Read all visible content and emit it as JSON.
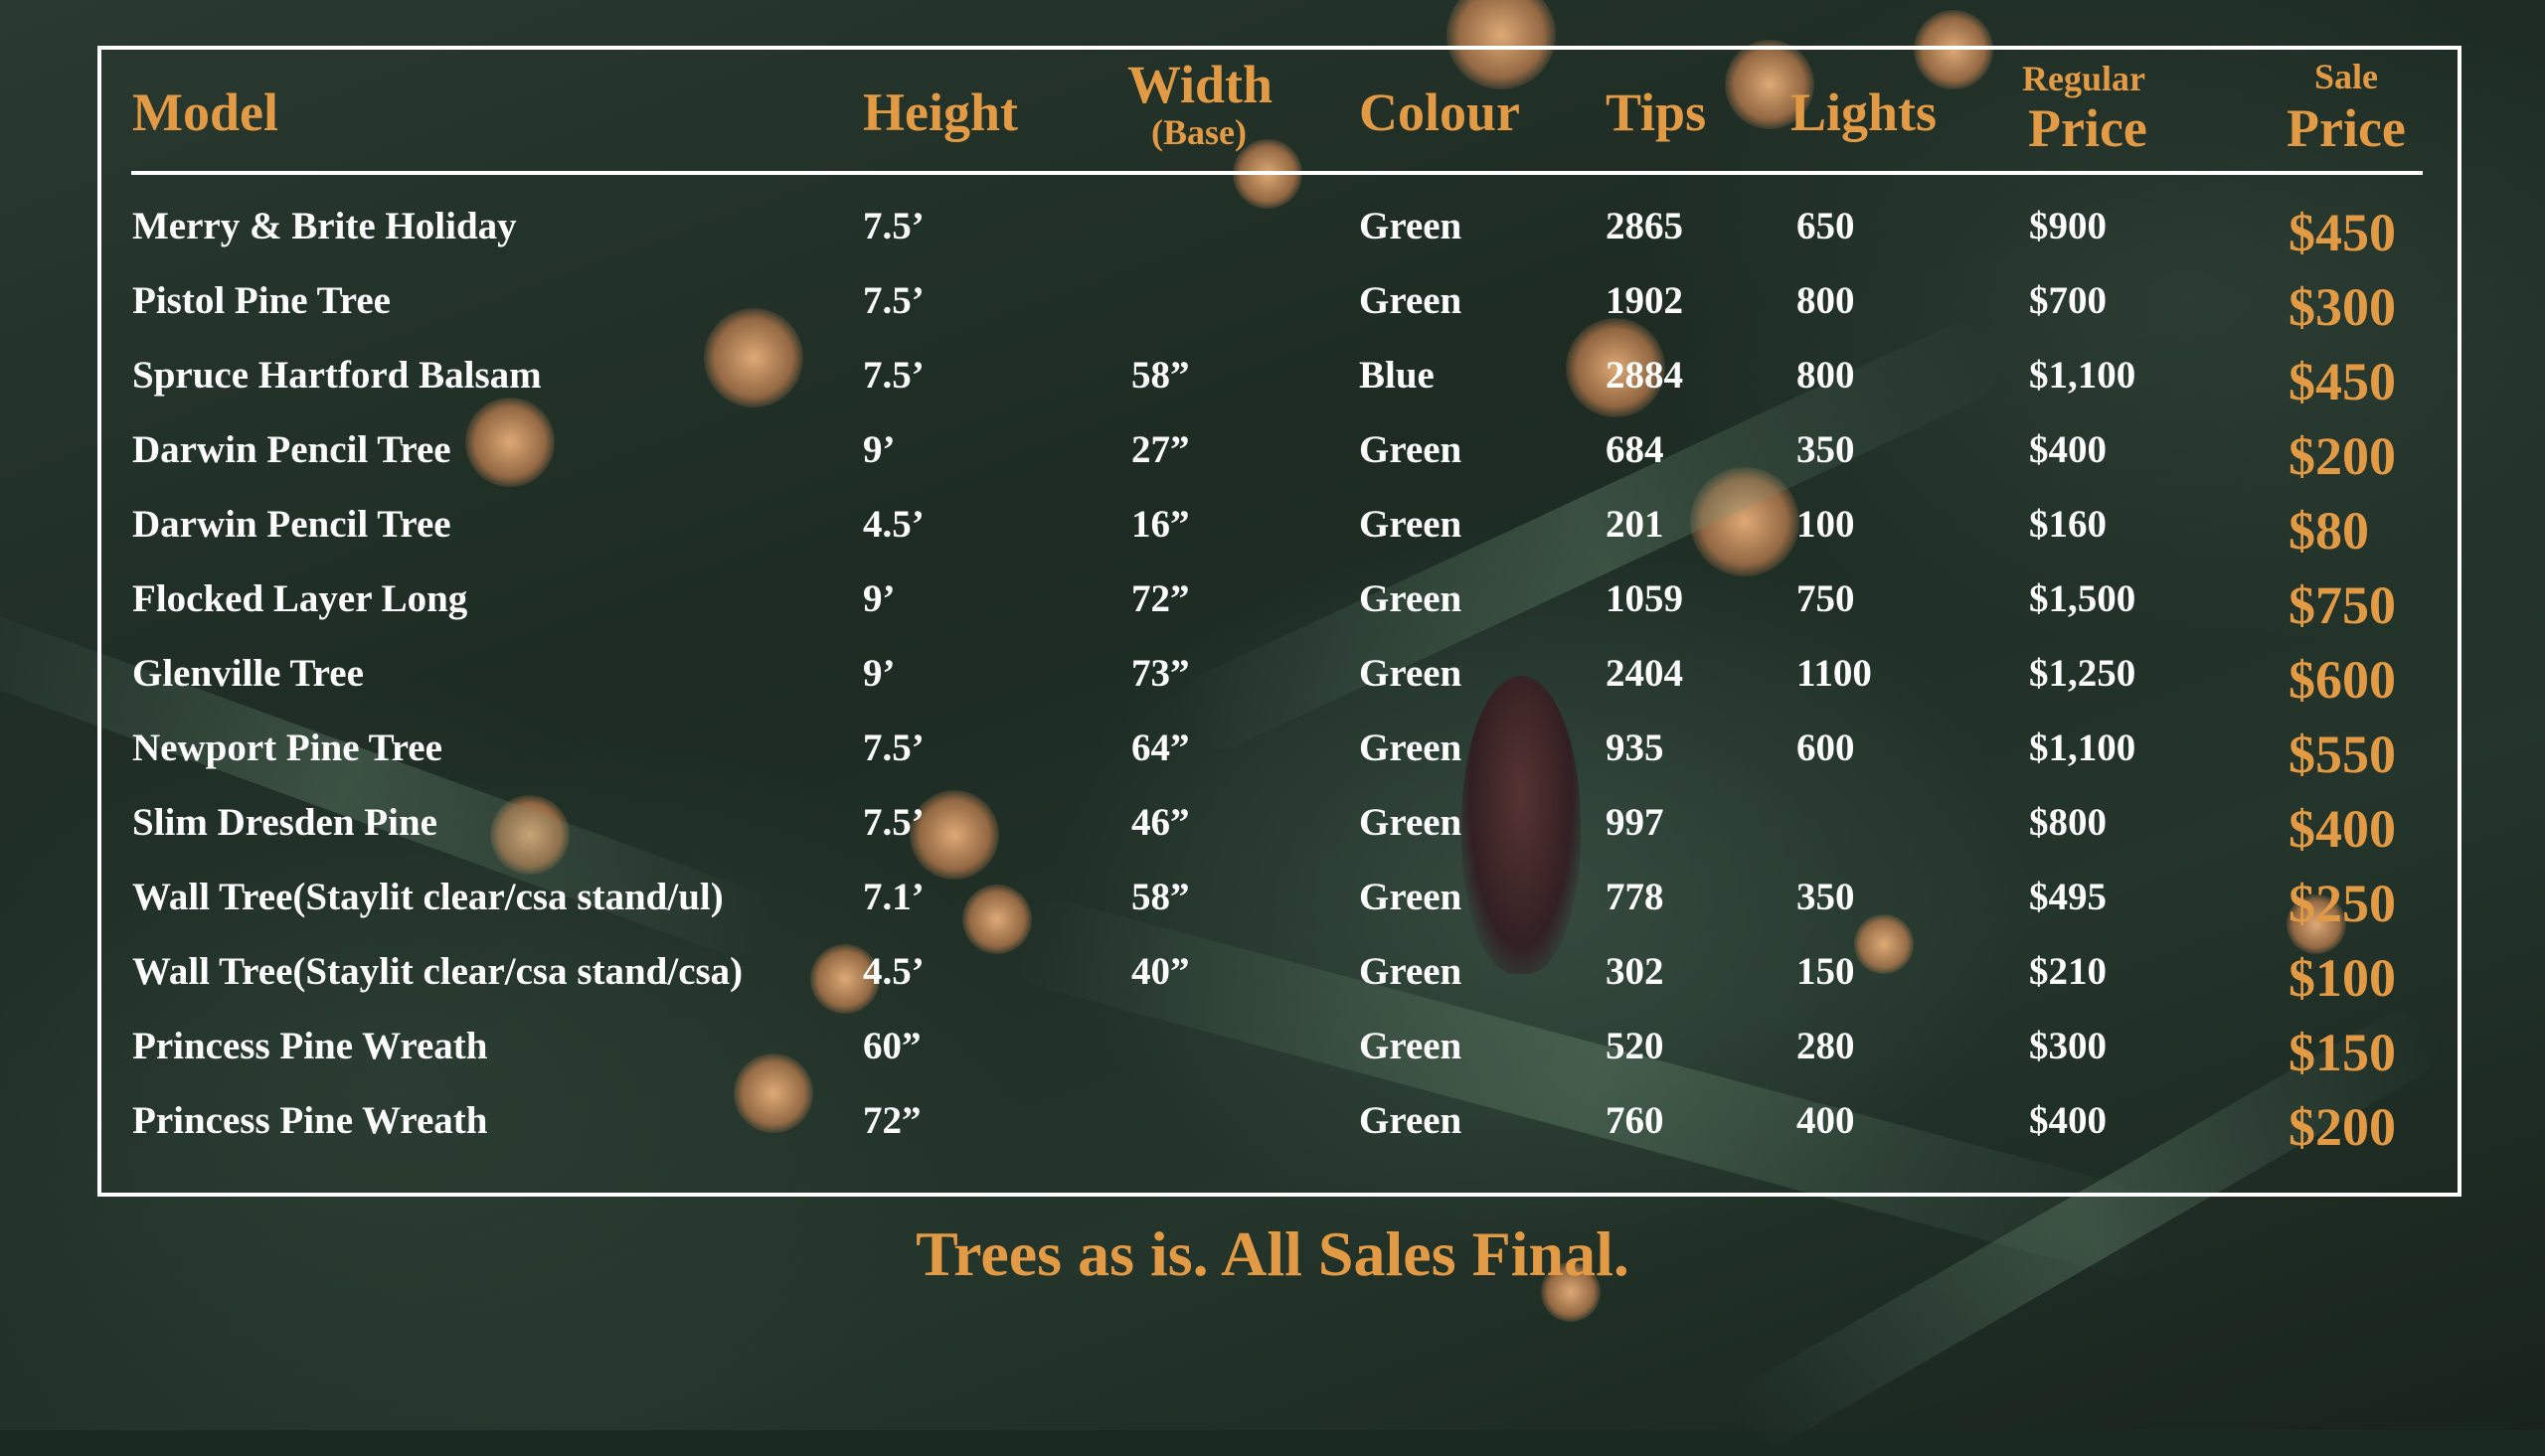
{
  "colors": {
    "accent": "#e39a44",
    "text": "#ffffff",
    "border": "#ffffff"
  },
  "header": {
    "model": "Model",
    "height": "Height",
    "width": "Width",
    "width_sub": "(Base)",
    "colour": "Colour",
    "tips": "Tips",
    "lights": "Lights",
    "regular_top": "Regular",
    "regular_bottom": "Price",
    "sale_top": "Sale",
    "sale_bottom": "Price"
  },
  "rows": [
    {
      "model": "Merry & Brite Holiday",
      "height": "7.5’",
      "width": "",
      "colour": "Green",
      "tips": "2865",
      "lights": "650",
      "regular": "$900",
      "sale": "$450"
    },
    {
      "model": "Pistol Pine Tree",
      "height": "7.5’",
      "width": "",
      "colour": "Green",
      "tips": "1902",
      "lights": "800",
      "regular": "$700",
      "sale": "$300"
    },
    {
      "model": "Spruce Hartford Balsam",
      "height": "7.5’",
      "width": "58”",
      "colour": "Blue",
      "tips": "2884",
      "lights": "800",
      "regular": "$1,100",
      "sale": "$450"
    },
    {
      "model": "Darwin Pencil Tree",
      "height": "9’",
      "width": "27”",
      "colour": "Green",
      "tips": "684",
      "lights": "350",
      "regular": "$400",
      "sale": "$200"
    },
    {
      "model": "Darwin Pencil Tree",
      "height": "4.5’",
      "width": "16”",
      "colour": "Green",
      "tips": "201",
      "lights": "100",
      "regular": "$160",
      "sale": "$80"
    },
    {
      "model": "Flocked Layer Long",
      "height": "9’",
      "width": "72”",
      "colour": "Green",
      "tips": "1059",
      "lights": "750",
      "regular": "$1,500",
      "sale": "$750"
    },
    {
      "model": "Glenville Tree",
      "height": "9’",
      "width": "73”",
      "colour": "Green",
      "tips": "2404",
      "lights": "1100",
      "regular": "$1,250",
      "sale": "$600"
    },
    {
      "model": "Newport Pine Tree",
      "height": "7.5’",
      "width": "64”",
      "colour": "Green",
      "tips": "935",
      "lights": "600",
      "regular": "$1,100",
      "sale": "$550"
    },
    {
      "model": "Slim Dresden Pine",
      "height": "7.5’",
      "width": "46”",
      "colour": "Green",
      "tips": "997",
      "lights": "",
      "regular": "$800",
      "sale": "$400"
    },
    {
      "model": "Wall Tree(Staylit clear/csa stand/ul)",
      "height": "7.1’",
      "width": "58”",
      "colour": "Green",
      "tips": "778",
      "lights": "350",
      "regular": "$495",
      "sale": "$250"
    },
    {
      "model": "Wall Tree(Staylit clear/csa stand/csa)",
      "height": "4.5’",
      "width": "40”",
      "colour": "Green",
      "tips": "302",
      "lights": "150",
      "regular": "$210",
      "sale": "$100"
    },
    {
      "model": "Princess Pine Wreath",
      "height": "60”",
      "width": "",
      "colour": "Green",
      "tips": "520",
      "lights": "280",
      "regular": "$300",
      "sale": "$150"
    },
    {
      "model": "Princess Pine Wreath",
      "height": "72”",
      "width": "",
      "colour": "Green",
      "tips": "760",
      "lights": "400",
      "regular": "$400",
      "sale": "$200"
    }
  ],
  "footer": "Trees as is. All Sales Final."
}
